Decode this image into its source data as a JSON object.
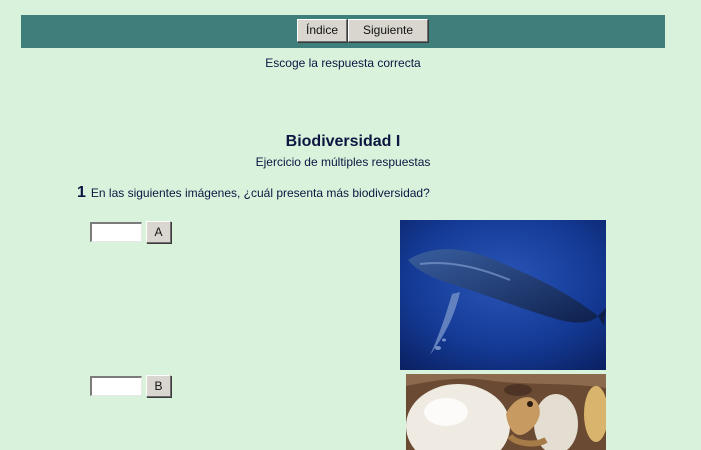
{
  "nav": {
    "index_label": "Índice",
    "next_label": "Siguiente"
  },
  "instruction": "Escoge la respuesta correcta",
  "exercise": {
    "title": "Biodiversidad I",
    "subtitle": "Ejercicio de múltiples respuestas"
  },
  "question": {
    "number": "1",
    "text": "En las siguientes imágenes, ¿cuál presenta más biodiversidad?",
    "options": [
      {
        "label": "A",
        "value": "",
        "image": "whale-photo"
      },
      {
        "label": "B",
        "value": "",
        "image": "eggs-hatchling-photo"
      }
    ]
  },
  "colors": {
    "background": "#d8f2dc",
    "navbar": "#3e7f7c",
    "button_face": "#d9d6cf",
    "text": "#0d1640"
  }
}
